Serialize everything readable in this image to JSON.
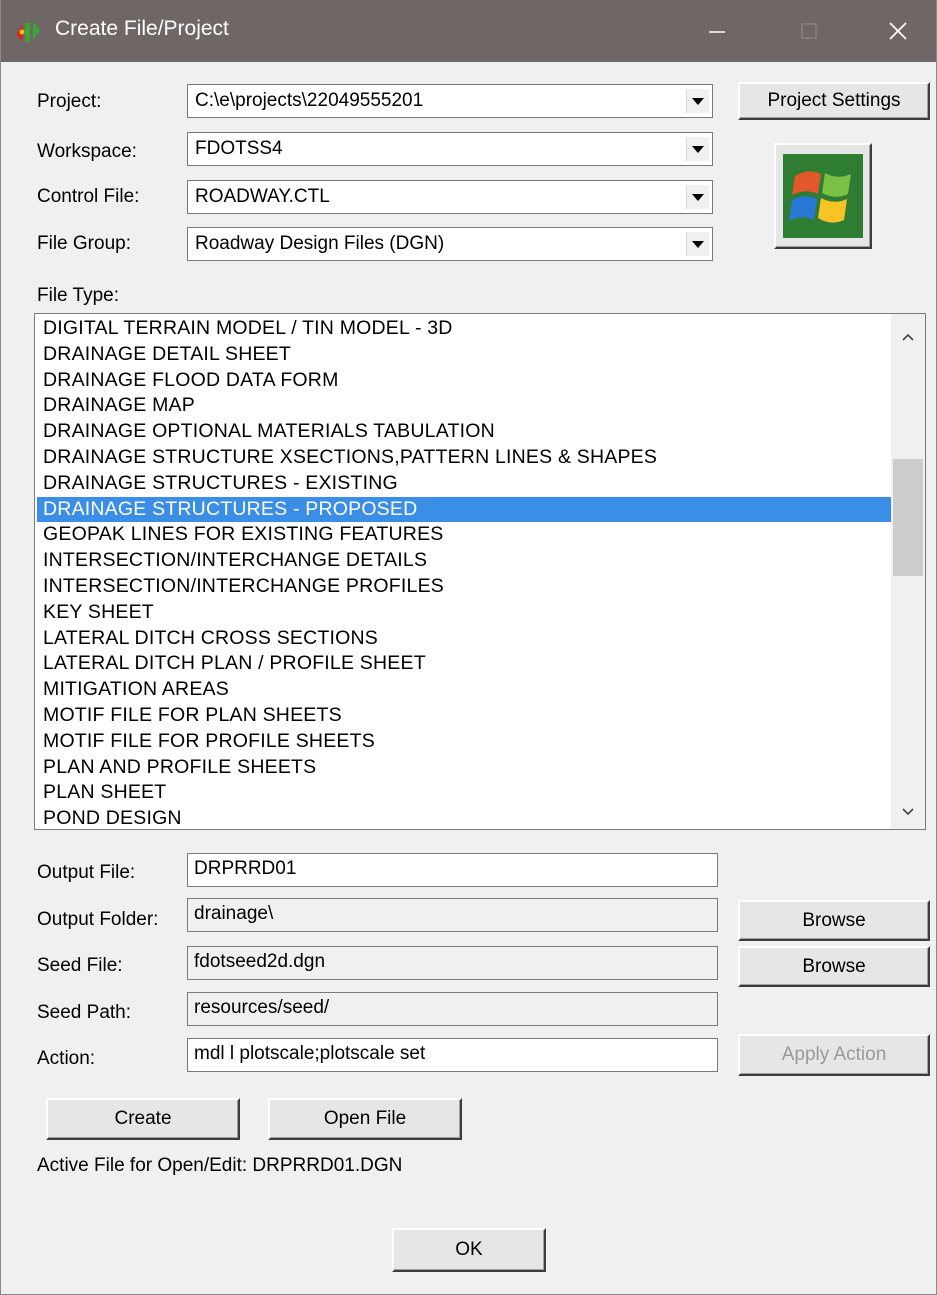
{
  "window": {
    "title": "Create File/Project",
    "minimize_glyph": "—",
    "maximize_glyph": "☐",
    "close_glyph": "✕"
  },
  "form": {
    "project": {
      "label": "Project:",
      "value": "C:\\e\\projects\\22049555201"
    },
    "workspace": {
      "label": "Workspace:",
      "value": "FDOTSS4"
    },
    "control_file": {
      "label": "Control File:",
      "value": "ROADWAY.CTL"
    },
    "file_group": {
      "label": "File Group:",
      "value": "Roadway Design Files (DGN)"
    },
    "project_settings_button": "Project Settings",
    "file_type_label": "File Type:"
  },
  "file_types": [
    "DIGITAL TERRAIN MODEL / TIN MODEL - 3D",
    "DRAINAGE DETAIL SHEET",
    "DRAINAGE FLOOD DATA FORM",
    "DRAINAGE MAP",
    "DRAINAGE OPTIONAL MATERIALS TABULATION",
    "DRAINAGE STRUCTURE XSECTIONS,PATTERN LINES & SHAPES",
    "DRAINAGE STRUCTURES - EXISTING",
    "DRAINAGE STRUCTURES - PROPOSED",
    "GEOPAK LINES FOR EXISTING FEATURES",
    "INTERSECTION/INTERCHANGE DETAILS",
    "INTERSECTION/INTERCHANGE PROFILES",
    "KEY SHEET",
    "LATERAL DITCH CROSS SECTIONS",
    "LATERAL DITCH PLAN / PROFILE SHEET",
    "MITIGATION AREAS",
    "MOTIF FILE FOR PLAN SHEETS",
    "MOTIF FILE FOR PROFILE SHEETS",
    "PLAN AND PROFILE SHEETS",
    "PLAN SHEET",
    "POND DESIGN"
  ],
  "selected_file_type": "DRAINAGE STRUCTURES - PROPOSED",
  "output": {
    "output_file": {
      "label": "Output File:",
      "value": "DRPRRD01"
    },
    "output_folder": {
      "label": "Output Folder:",
      "value": "drainage\\"
    },
    "seed_file": {
      "label": "Seed File:",
      "value": "fdotseed2d.dgn"
    },
    "seed_path": {
      "label": "Seed Path:",
      "value": "resources/seed/"
    },
    "action": {
      "label": "Action:",
      "value": "mdl l plotscale;plotscale set"
    },
    "browse_label": "Browse",
    "apply_action_label": "Apply Action"
  },
  "buttons": {
    "create": "Create",
    "open_file": "Open File",
    "ok": "OK"
  },
  "active_file_text": "Active File for Open/Edit:  DRPRRD01.DGN",
  "colors": {
    "titlebar": "#6e6765",
    "selection": "#3a8ee6",
    "dialog_bg": "#f0f0f0"
  },
  "icons": [
    "app-icon",
    "minimize-icon",
    "maximize-icon",
    "close-icon",
    "dropdown-arrow-icon",
    "windows-logo-icon",
    "scroll-up-icon",
    "scroll-down-icon"
  ]
}
